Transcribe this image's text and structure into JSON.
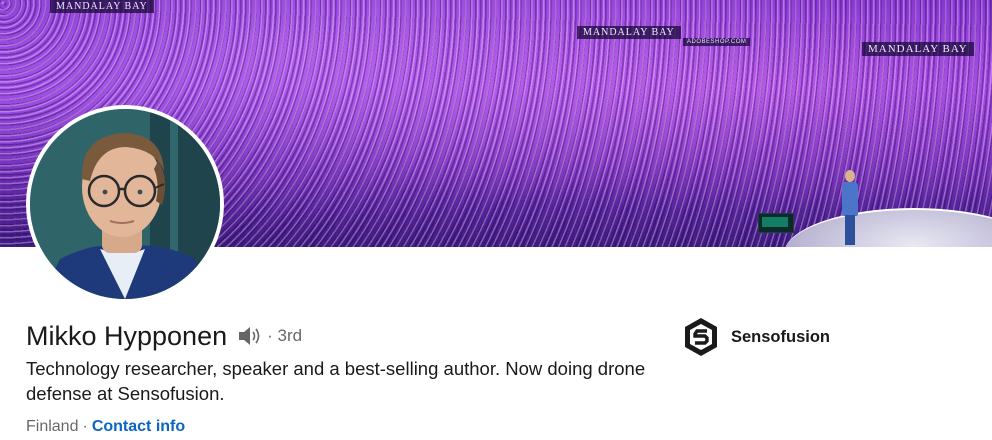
{
  "banner": {
    "signs": [
      "MANDALAY BAY",
      "MANDALAY BAY",
      "MANDALAY BAY"
    ],
    "small_sign": "ADOBESHOP.COM"
  },
  "profile": {
    "name": "Mikko Hypponen",
    "connection_degree": "· 3rd",
    "headline": "Technology researcher, speaker and a best-selling author. Now doing drone defense at Sensofusion.",
    "location": "Finland",
    "separator": "·",
    "contact_info_label": "Contact info"
  },
  "current_company": {
    "name": "Sensofusion",
    "logo_icon": "sensofusion-logo"
  },
  "icons": {
    "pronunciation": "speaker-icon"
  },
  "colors": {
    "link": "#0a66c2",
    "banner_purple": "#7a2fd0"
  }
}
